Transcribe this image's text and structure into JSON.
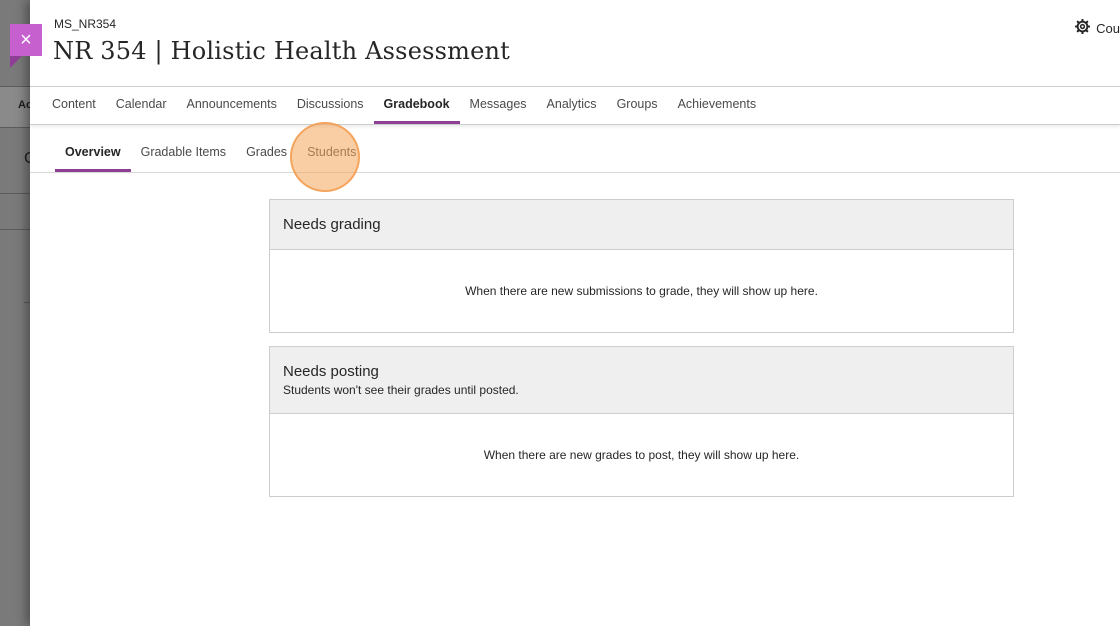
{
  "background": {
    "fragment_a": "Ac",
    "fragment_b": "C"
  },
  "panel": {
    "close_glyph": "×",
    "course_code": "MS_NR354",
    "course_title": "NR 354 | Holistic Health Assessment",
    "settings_label": "Cou",
    "settings_icon": "gear-icon"
  },
  "top_nav": {
    "tabs": [
      {
        "label": "Content"
      },
      {
        "label": "Calendar"
      },
      {
        "label": "Announcements"
      },
      {
        "label": "Discussions"
      },
      {
        "label": "Gradebook",
        "active": true
      },
      {
        "label": "Messages"
      },
      {
        "label": "Analytics"
      },
      {
        "label": "Groups"
      },
      {
        "label": "Achievements"
      }
    ]
  },
  "sub_nav": {
    "tabs": [
      {
        "label": "Overview",
        "active": true
      },
      {
        "label": "Gradable Items"
      },
      {
        "label": "Grades"
      },
      {
        "label": "Students"
      }
    ]
  },
  "cards": {
    "needs_grading": {
      "title": "Needs grading",
      "empty_text": "When there are new submissions to grade, they will show up here."
    },
    "needs_posting": {
      "title": "Needs posting",
      "subtitle": "Students won't see their grades until posted.",
      "empty_text": "When there are new grades to post, they will show up here."
    }
  },
  "colors": {
    "accent": "#8f3e96",
    "close_button": "#c760cf",
    "click_marker": "#f5a55a"
  }
}
